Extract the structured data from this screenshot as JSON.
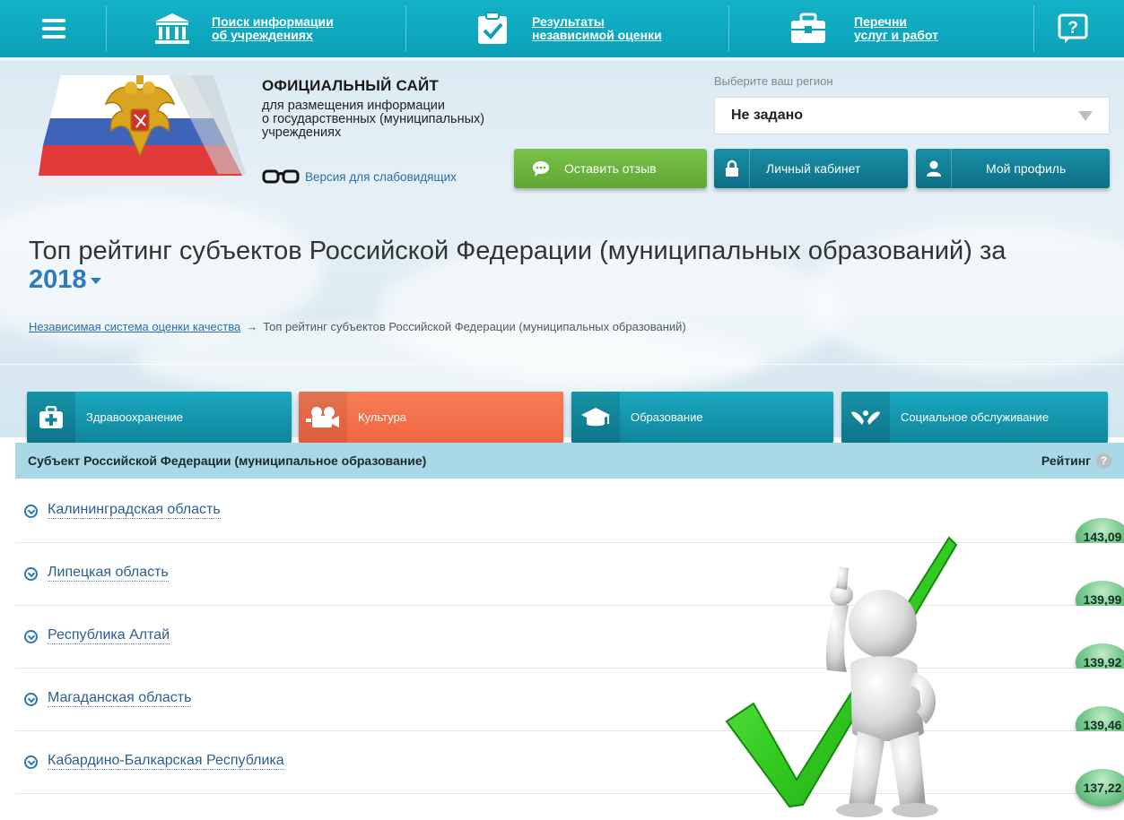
{
  "topbar": {
    "links": [
      {
        "line1": "Поиск информации",
        "line2": "об учреждениях"
      },
      {
        "line1": "Результаты",
        "line2": "независимой оценки"
      },
      {
        "line1": "Перечни",
        "line2": "услуг и работ"
      }
    ]
  },
  "header": {
    "site_title": "ОФИЦИАЛЬНЫЙ САЙТ",
    "site_subtitle": "для размещения информации\nо государственных (муниципальных)\nучреждениях",
    "low_vision_label": "Версия для слабовидящих",
    "region_label": "Выберите ваш регион",
    "region_value": "Не задано",
    "buttons": {
      "feedback": "Оставить отзыв",
      "cabinet": "Личный кабинет",
      "profile": "Мой профиль"
    }
  },
  "page": {
    "title": "Топ рейтинг субъектов Российской Федерации (муниципальных образований) за",
    "year": "2018",
    "breadcrumb_link": "Независимая система оценки качества",
    "breadcrumb_arrow": "→",
    "breadcrumb_current": "Топ рейтинг субъектов Российской Федерации (муниципальных образований)"
  },
  "tabs": [
    {
      "label": "Здравоохранение",
      "icon": "first-aid-kit-icon",
      "active": false
    },
    {
      "label": "Культура",
      "icon": "film-camera-icon",
      "active": true
    },
    {
      "label": "Образование",
      "icon": "graduation-cap-icon",
      "active": false
    },
    {
      "label": "Социальное обслуживание",
      "icon": "caring-hands-icon",
      "active": false
    }
  ],
  "table": {
    "col_subject": "Субъект Российской Федерации (муниципальное образование)",
    "col_rating": "Рейтинг",
    "help_glyph": "?",
    "rows": [
      {
        "name": "Калининградская область",
        "score": "143,09"
      },
      {
        "name": "Липецкая область",
        "score": "139,99"
      },
      {
        "name": "Республика Алтай",
        "score": "139,92"
      },
      {
        "name": "Магаданская область",
        "score": "139,46"
      },
      {
        "name": "Кабардино-Балкарская Республика",
        "score": "137,22"
      }
    ]
  },
  "colors": {
    "topbar": "#0aa0b6",
    "accent_green": "#5fa834",
    "active_tab": "#ef6642",
    "table_header": "#a9d8e6",
    "score_badge": "#5ab676"
  }
}
